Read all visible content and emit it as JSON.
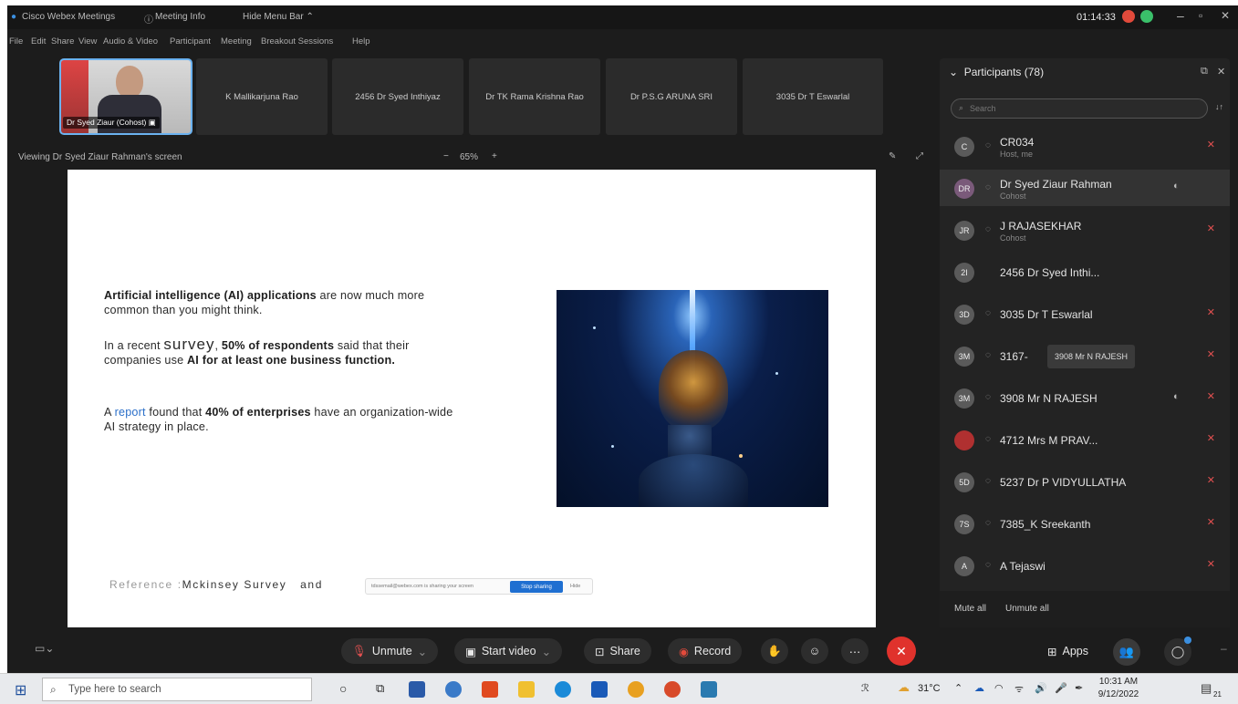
{
  "titlebar": {
    "app": "Cisco Webex Meetings",
    "meeting_info": "Meeting Info",
    "hide_menu": "Hide Menu Bar",
    "timer": "01:14:33"
  },
  "menu": [
    "File",
    "Edit",
    "Share",
    "View",
    "Audio & Video",
    "Participant",
    "Meeting",
    "Breakout Sessions",
    "Help"
  ],
  "thumbnails": {
    "active_label": "Dr Syed Ziaur (Cohost)",
    "items": [
      "K Mallikarjuna Rao",
      "2456 Dr Syed Inthiyaz",
      "Dr TK Rama Krishna Rao",
      "Dr P.S.G ARUNA SRI",
      "3035 Dr T Eswarlal"
    ]
  },
  "viewing": {
    "label": "Viewing Dr Syed Ziaur Rahman's screen",
    "zoom": "65%",
    "minus": "−",
    "plus": "+"
  },
  "slide": {
    "p1_bold": "Artificial intelligence (AI) applications",
    "p1_rest": " are now much more common than you might think.",
    "p2_a": "In a recent ",
    "p2_survey": "survey",
    "p2_b": ", ",
    "p2_bold1": "50% of respondents",
    "p2_c": " said that their companies use ",
    "p2_bold2": "AI for at least one business function.",
    "p3_a": "A ",
    "p3_link": "report",
    "p3_b": " found that ",
    "p3_bold": "40% of enterprises",
    "p3_c": " have an organization-wide AI strategy in place.",
    "ref_label": "Reference :",
    "ref_text": "Mckinsey Survey",
    "ref_and": "and",
    "share_banner": "tdssemail@webex.com is sharing your screen",
    "stop_sharing": "Stop sharing",
    "hide": "Hide"
  },
  "participants": {
    "header": "Participants (78)",
    "search_placeholder": "Search",
    "list": [
      {
        "initials": "C",
        "name": "CR034",
        "role": "Host, me"
      },
      {
        "initials": "DR",
        "name": "Dr Syed Ziaur Rahman",
        "role": "Cohost"
      },
      {
        "initials": "JR",
        "name": "J RAJASEKHAR",
        "role": "Cohost"
      },
      {
        "initials": "2I",
        "name": "2456 Dr Syed Inthi...",
        "role": ""
      },
      {
        "initials": "3D",
        "name": "3035 Dr T Eswarlal",
        "role": ""
      },
      {
        "initials": "3M",
        "name": "3167-",
        "role": ""
      },
      {
        "initials": "3M",
        "name": "3908 Mr N RAJESH",
        "role": ""
      },
      {
        "initials": "",
        "name": "4712 Mrs M PRAV...",
        "role": ""
      },
      {
        "initials": "5D",
        "name": "5237 Dr P VIDYULLATHA",
        "role": ""
      },
      {
        "initials": "7S",
        "name": "7385_K Sreekanth",
        "role": ""
      },
      {
        "initials": "A",
        "name": "A Tejaswi",
        "role": ""
      }
    ],
    "tooltip": "3908 Mr N RAJESH",
    "mute_all": "Mute all",
    "unmute_all": "Unmute all"
  },
  "toolbar": {
    "unmute": "Unmute",
    "start_video": "Start video",
    "share": "Share",
    "record": "Record",
    "apps": "Apps"
  },
  "taskbar": {
    "search_placeholder": "Type here to search",
    "temp": "31°C",
    "time": "10:31 AM",
    "date": "9/12/2022",
    "notif": "21"
  }
}
